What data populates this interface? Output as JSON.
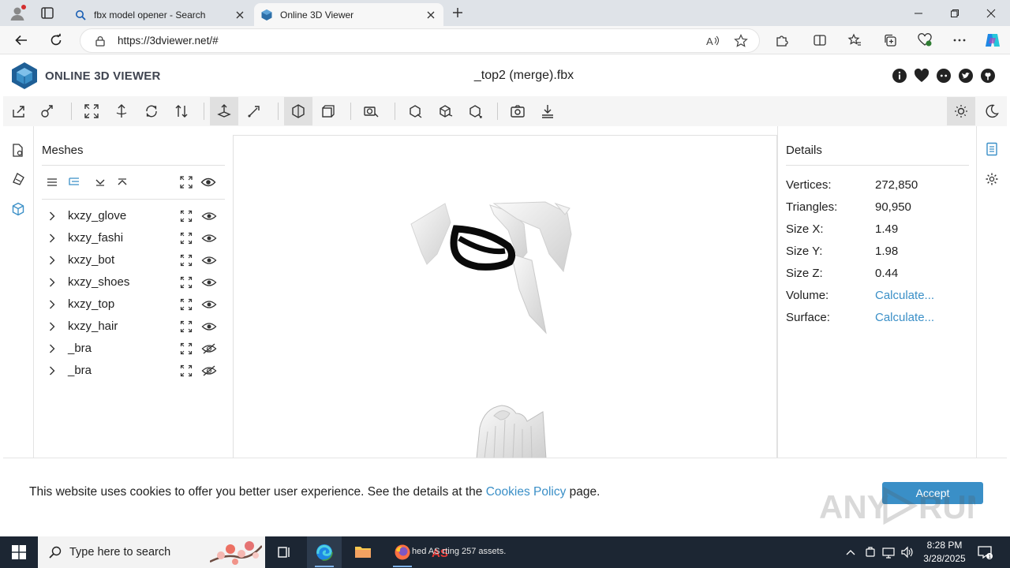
{
  "browser": {
    "tabs": [
      {
        "title": "fbx model opener - Search",
        "active": false
      },
      {
        "title": "Online 3D Viewer",
        "active": true
      }
    ],
    "url": "https://3dviewer.net/#"
  },
  "app": {
    "brand": "ONLINE 3D VIEWER",
    "file_name": "_top2 (merge).fbx",
    "accent_color": "#3a8fc7"
  },
  "meshes": {
    "title": "Meshes",
    "items": [
      {
        "name": "kxzy_glove",
        "visible": true
      },
      {
        "name": "kxzy_fashi",
        "visible": true
      },
      {
        "name": "kxzy_bot",
        "visible": true
      },
      {
        "name": "kxzy_shoes",
        "visible": true
      },
      {
        "name": "kxzy_top",
        "visible": true
      },
      {
        "name": "kxzy_hair",
        "visible": true
      },
      {
        "name": "_bra",
        "visible": false
      },
      {
        "name": "_bra",
        "visible": false
      }
    ]
  },
  "details": {
    "title": "Details",
    "rows": [
      {
        "label": "Vertices:",
        "value": "272,850"
      },
      {
        "label": "Triangles:",
        "value": "90,950"
      },
      {
        "label": "Size X:",
        "value": "1.49"
      },
      {
        "label": "Size Y:",
        "value": "1.98"
      },
      {
        "label": "Size Z:",
        "value": "0.44"
      },
      {
        "label": "Volume:",
        "value": "Calculate..."
      },
      {
        "label": "Surface:",
        "value": "Calculate..."
      }
    ]
  },
  "cookie": {
    "text_before": "This website uses cookies to offer you better user experience. See the details at the ",
    "link": "Cookies Policy",
    "text_after": " page.",
    "accept": "Accept"
  },
  "taskbar": {
    "search_placeholder": "Type here to search",
    "firefox_label": "hed  AS  rting 257 assets.",
    "time": "8:28 PM",
    "date": "3/28/2025"
  }
}
